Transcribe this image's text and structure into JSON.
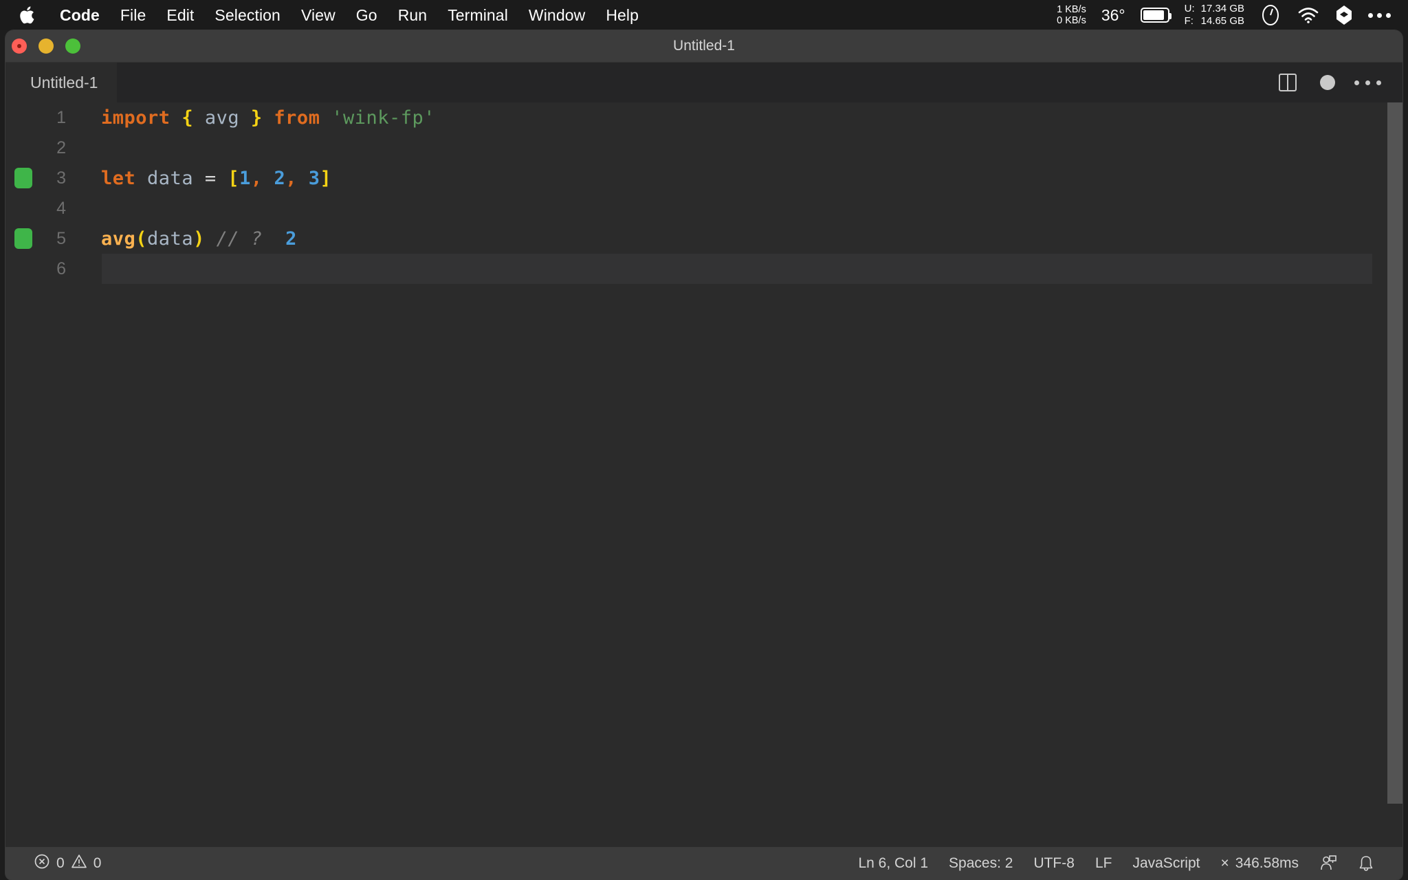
{
  "menubar": {
    "apple_icon": "apple-logo-icon",
    "items": [
      {
        "label": "Code",
        "bold": true
      },
      {
        "label": "File",
        "bold": false
      },
      {
        "label": "Edit",
        "bold": false
      },
      {
        "label": "Selection",
        "bold": false
      },
      {
        "label": "View",
        "bold": false
      },
      {
        "label": "Go",
        "bold": false
      },
      {
        "label": "Run",
        "bold": false
      },
      {
        "label": "Terminal",
        "bold": false
      },
      {
        "label": "Window",
        "bold": false
      },
      {
        "label": "Help",
        "bold": false
      }
    ],
    "status": {
      "net_up": "1 KB/s",
      "net_down": "0 KB/s",
      "temperature": "36°",
      "battery_icon": "battery-icon",
      "mem_used_label": "U:",
      "mem_used_value": "17.34 GB",
      "mem_free_label": "F:",
      "mem_free_value": "14.65 GB",
      "clock_icon": "clock-icon",
      "wifi_icon": "wifi-icon",
      "dropbox_icon": "dropbox-icon",
      "more_icon": "ellipsis-icon"
    }
  },
  "window": {
    "title": "Untitled-1",
    "traffic_lights": [
      "close-button",
      "minimize-button",
      "zoom-button"
    ]
  },
  "tabbar": {
    "tab_label": "Untitled-1",
    "split_editor_icon": "split-editor-icon",
    "unsaved_indicator": "unsaved-dot-icon",
    "more_actions_icon": "ellipsis-icon"
  },
  "editor": {
    "lines": [
      {
        "num": "1",
        "marker": false,
        "active": false
      },
      {
        "num": "2",
        "marker": false,
        "active": false
      },
      {
        "num": "3",
        "marker": true,
        "active": false
      },
      {
        "num": "4",
        "marker": false,
        "active": false
      },
      {
        "num": "5",
        "marker": true,
        "active": false
      },
      {
        "num": "6",
        "marker": false,
        "active": true
      }
    ],
    "code": {
      "l1_import": "import",
      "l1_brace_open": "{",
      "l1_avg": "avg",
      "l1_brace_close": "}",
      "l1_from": "from",
      "l1_string": "'wink-fp'",
      "l3_let": "let",
      "l3_data": "data",
      "l3_eq": "=",
      "l3_bracket_open": "[",
      "l3_n1": "1",
      "l3_c1": ",",
      "l3_n2": "2",
      "l3_c2": ",",
      "l3_n3": "3",
      "l3_bracket_close": "]",
      "l5_fn": "avg",
      "l5_paren_open": "(",
      "l5_arg": "data",
      "l5_paren_close": ")",
      "l5_comment": "//",
      "l5_question": "?",
      "l5_result": "2"
    },
    "colors": {
      "keyword": "#e06c20",
      "bracket": "#f5d315",
      "identifier": "#a9b7c6",
      "string": "#5d9a5e",
      "number": "#4a9ddb",
      "function": "#fcb250",
      "comment": "#808080",
      "coverage_marker": "#3fb549",
      "editor_background": "#2b2b2b"
    }
  },
  "statusbar": {
    "error_icon": "error-circle-icon",
    "error_count": "0",
    "warning_icon": "warning-triangle-icon",
    "warning_count": "0",
    "cursor_position": "Ln 6, Col 1",
    "indentation": "Spaces: 2",
    "encoding": "UTF-8",
    "line_ending": "LF",
    "language_mode": "JavaScript",
    "quokka_icon": "×",
    "quokka_time": "346.58ms",
    "remote_icon": "remote-account-icon",
    "notifications_icon": "bell-icon"
  }
}
